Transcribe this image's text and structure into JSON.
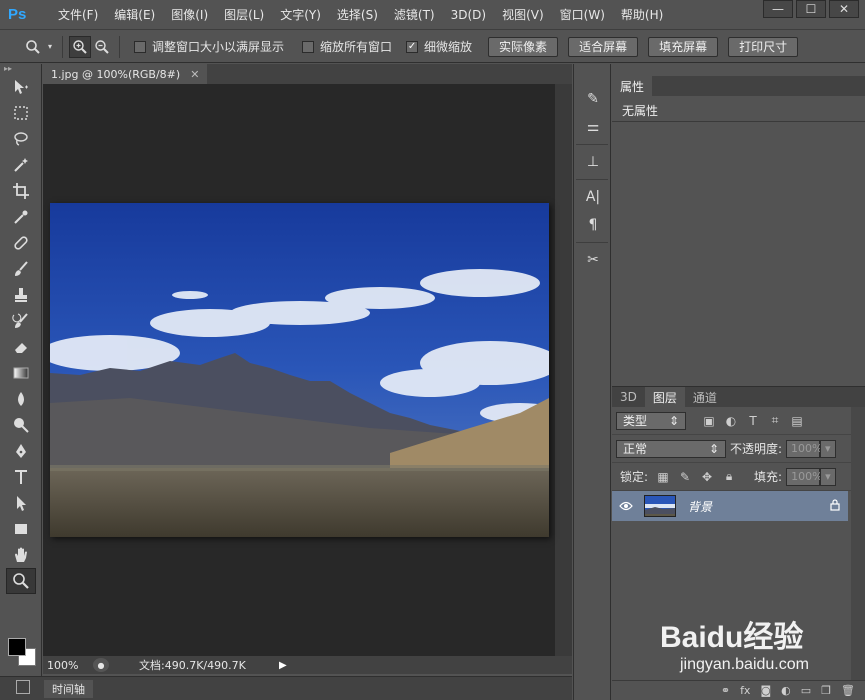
{
  "app": {
    "logo": "Ps"
  },
  "menu": [
    "文件(F)",
    "编辑(E)",
    "图像(I)",
    "图层(L)",
    "文字(Y)",
    "选择(S)",
    "滤镜(T)",
    "3D(D)",
    "视图(V)",
    "窗口(W)",
    "帮助(H)"
  ],
  "window_controls": {
    "minimize": "—",
    "maximize": "☐",
    "close": "✕"
  },
  "options": {
    "resize_windows": {
      "label": "调整窗口大小以满屏显示",
      "checked": false
    },
    "zoom_all": {
      "label": "缩放所有窗口",
      "checked": false
    },
    "scrubby_zoom": {
      "label": "细微缩放",
      "checked": true
    },
    "actual_pixels": "实际像素",
    "fit_screen": "适合屏幕",
    "fill_screen": "填充屏幕",
    "print_size": "打印尺寸"
  },
  "document": {
    "tab_title": "1.jpg @ 100%(RGB/8#)",
    "zoom": "100%",
    "doc_size": "文档:490.7K/490.7K"
  },
  "timeline": {
    "label": "时间轴"
  },
  "properties": {
    "tab": "属性",
    "empty_text": "无属性"
  },
  "layers": {
    "tabs": [
      "3D",
      "图层",
      "通道"
    ],
    "active_tab": "图层",
    "filter_kind": "类型",
    "blend_mode": "正常",
    "opacity_label": "不透明度:",
    "opacity_value": "100%",
    "lock_label": "锁定:",
    "fill_label": "填充:",
    "fill_value": "100%",
    "items": [
      {
        "name": "背景",
        "visible": true,
        "locked": true
      }
    ]
  },
  "watermark": {
    "logo": "Baidu经验",
    "url": "jingyan.baidu.com"
  },
  "colors": {
    "panel": "#535353",
    "canvas_bg": "#282828",
    "selected_layer": "#6f8099",
    "ps_blue": "#31a8ff"
  }
}
